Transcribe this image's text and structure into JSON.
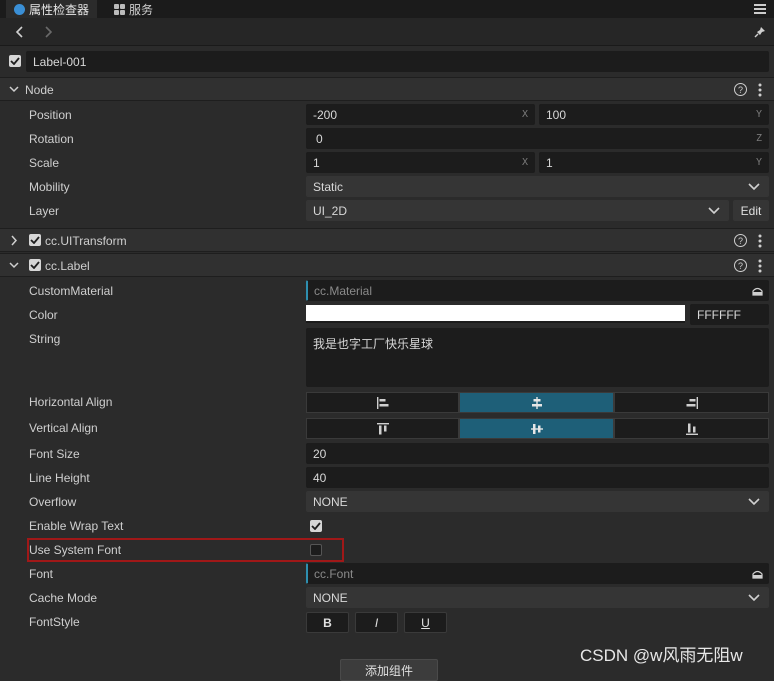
{
  "tabs": [
    {
      "label": "属性检查器",
      "icon": "inspector-icon"
    },
    {
      "label": "服务",
      "icon": "services-icon"
    }
  ],
  "node_name": "Label-001",
  "sections": {
    "node": "Node",
    "uitransform": "cc.UITransform",
    "label": "cc.Label"
  },
  "node_props": {
    "position_label": "Position",
    "position_x": "-200",
    "position_y": "100",
    "rotation_label": "Rotation",
    "rotation_z": "0",
    "scale_label": "Scale",
    "scale_x": "1",
    "scale_y": "1",
    "mobility_label": "Mobility",
    "mobility_value": "Static",
    "layer_label": "Layer",
    "layer_value": "UI_2D",
    "edit_label": "Edit"
  },
  "axes": {
    "x": "X",
    "y": "Y",
    "z": "Z"
  },
  "label_props": {
    "custom_material_label": "CustomMaterial",
    "custom_material_value": "cc.Material",
    "color_label": "Color",
    "color_hex": "FFFFFF",
    "color_swatch": "#ffffff",
    "string_label": "String",
    "string_value": "我是也字工厂快乐星球",
    "horizontal_align_label": "Horizontal Align",
    "vertical_align_label": "Vertical Align",
    "font_size_label": "Font Size",
    "font_size_value": "20",
    "line_height_label": "Line Height",
    "line_height_value": "40",
    "overflow_label": "Overflow",
    "overflow_value": "NONE",
    "wrap_label": "Enable Wrap Text",
    "wrap_checked": true,
    "system_font_label": "Use System Font",
    "system_font_checked": false,
    "font_label": "Font",
    "font_value": "cc.Font",
    "cache_mode_label": "Cache Mode",
    "cache_mode_value": "NONE",
    "font_style_label": "FontStyle",
    "bold": "B",
    "italic": "I",
    "underline": "U"
  },
  "add_component": "添加组件",
  "watermark": "CSDN @w风雨无阻w",
  "colors": {
    "accent": "#1e5f78",
    "highlight_border": "#a01818",
    "panel": "#2b2b2b"
  }
}
